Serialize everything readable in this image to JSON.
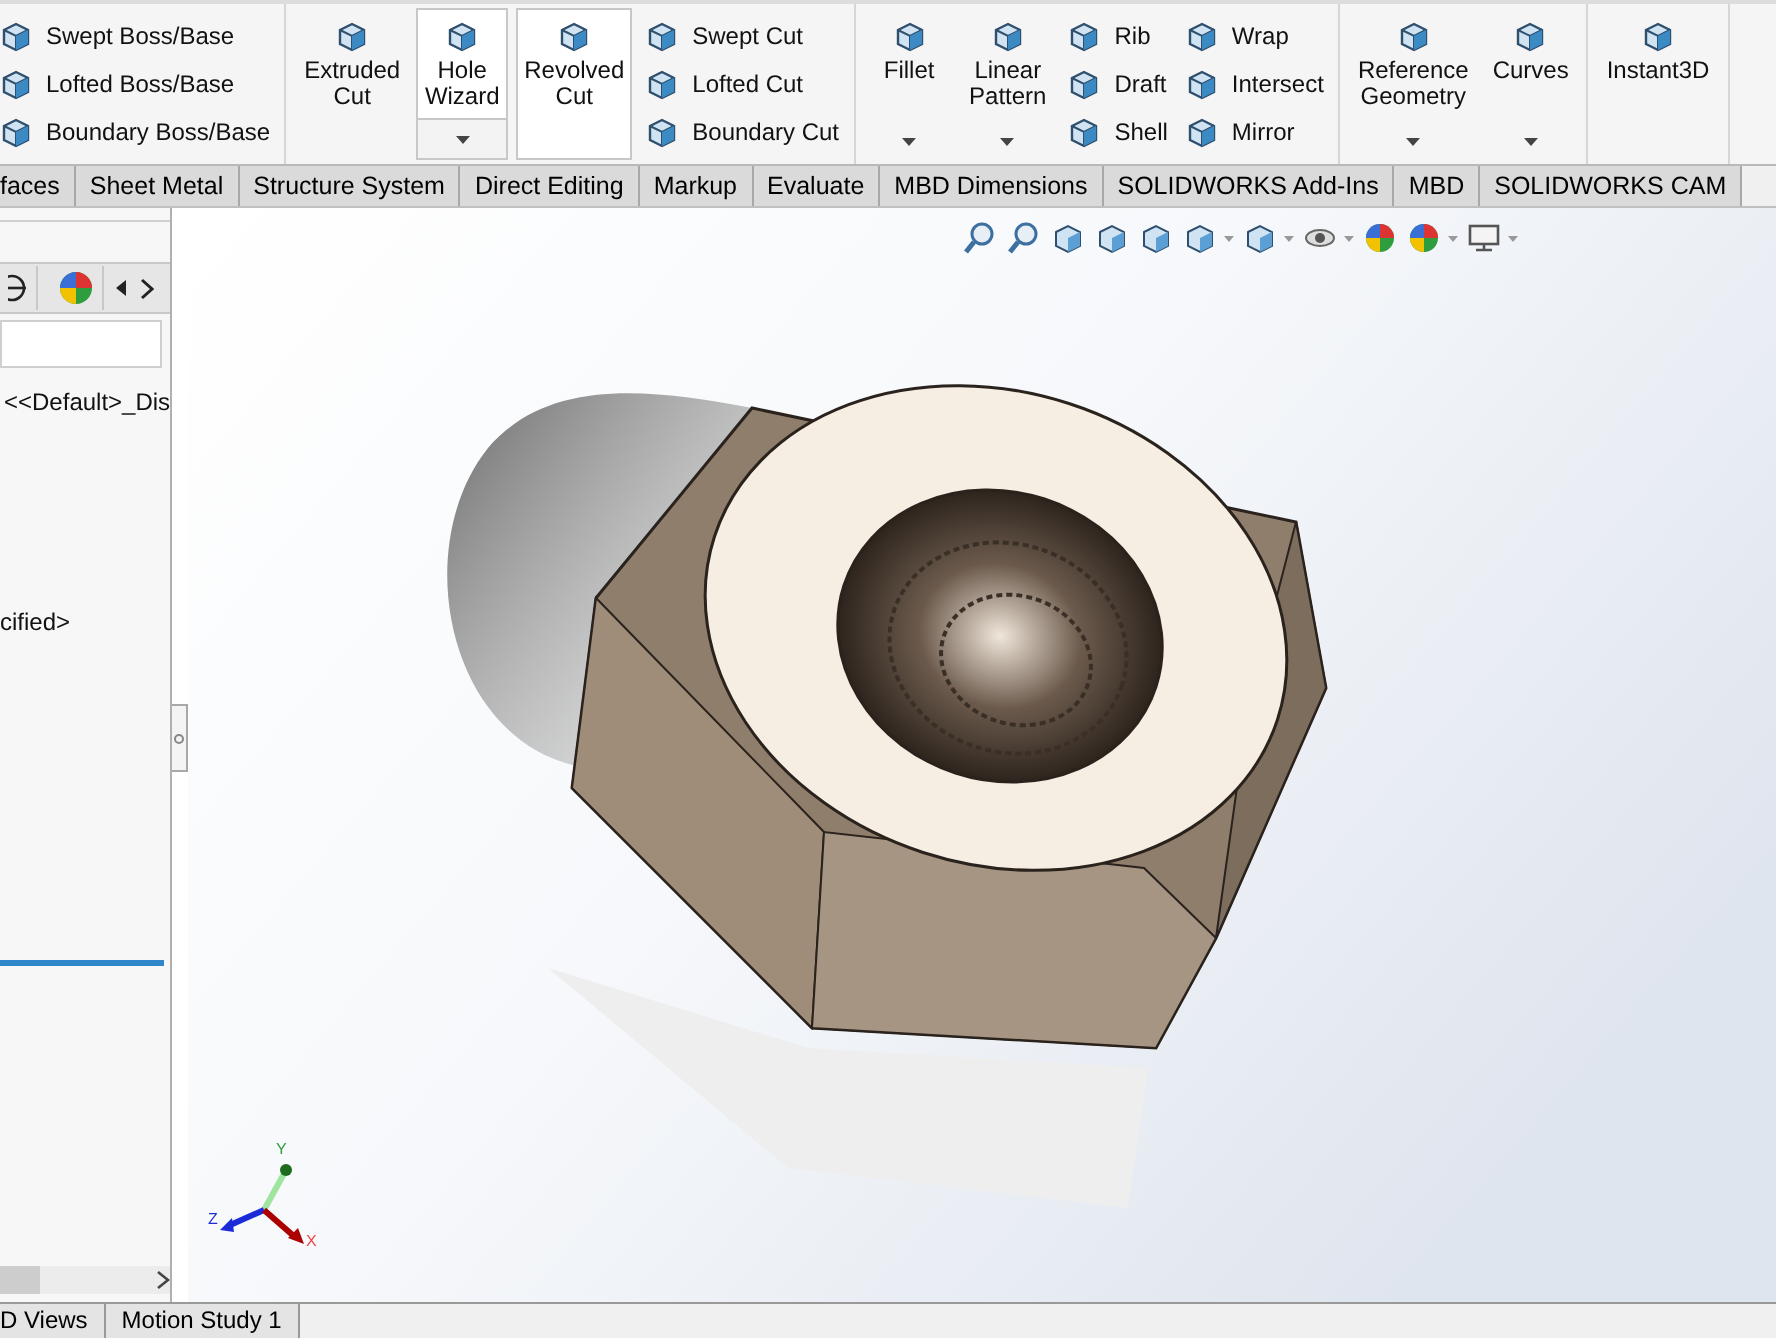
{
  "ribbon": {
    "groups": [
      {
        "items": [
          {
            "kind": "stack",
            "entries": [
              "Swept Boss/Base",
              "Lofted Boss/Base",
              "Boundary Boss/Base"
            ]
          }
        ]
      },
      {
        "items": [
          {
            "kind": "large",
            "label": "Extruded\nCut",
            "dropdown": false,
            "split": false,
            "highlighted": false
          },
          {
            "kind": "large",
            "label": "Hole\nWizard",
            "dropdown": true,
            "split": true,
            "highlighted": false
          },
          {
            "kind": "large",
            "label": "Revolved\nCut",
            "dropdown": false,
            "split": false,
            "highlighted": true
          },
          {
            "kind": "stack",
            "entries": [
              "Swept Cut",
              "Lofted Cut",
              "Boundary Cut"
            ]
          }
        ]
      },
      {
        "items": [
          {
            "kind": "large",
            "label": "Fillet",
            "dropdown": true,
            "split": false,
            "highlighted": false
          },
          {
            "kind": "large",
            "label": "Linear\nPattern",
            "dropdown": true,
            "split": false,
            "highlighted": false
          },
          {
            "kind": "stack",
            "entries": [
              "Rib",
              "Draft",
              "Shell"
            ]
          },
          {
            "kind": "stack",
            "entries": [
              "Wrap",
              "Intersect",
              "Mirror"
            ]
          }
        ]
      },
      {
        "items": [
          {
            "kind": "large",
            "label": "Reference\nGeometry",
            "dropdown": true,
            "split": false,
            "highlighted": false
          },
          {
            "kind": "large",
            "label": "Curves",
            "dropdown": true,
            "split": false,
            "highlighted": false
          }
        ]
      },
      {
        "items": [
          {
            "kind": "large",
            "label": "Instant3D",
            "dropdown": false,
            "split": false,
            "highlighted": false
          }
        ]
      }
    ]
  },
  "command_tabs": [
    "faces",
    "Sheet Metal",
    "Structure System",
    "Direct Editing",
    "Markup",
    "Evaluate",
    "MBD Dimensions",
    "SOLIDWORKS Add-Ins",
    "MBD",
    "SOLIDWORKS CAM"
  ],
  "feature_tree": {
    "lines": [
      "<<Default>_Dis",
      "cified>"
    ]
  },
  "viewport": {
    "kind": "picture",
    "triad": {
      "y": "Y",
      "z": "Z",
      "x": "X"
    }
  },
  "bottom_tabs": [
    "D Views",
    "Motion Study 1"
  ]
}
